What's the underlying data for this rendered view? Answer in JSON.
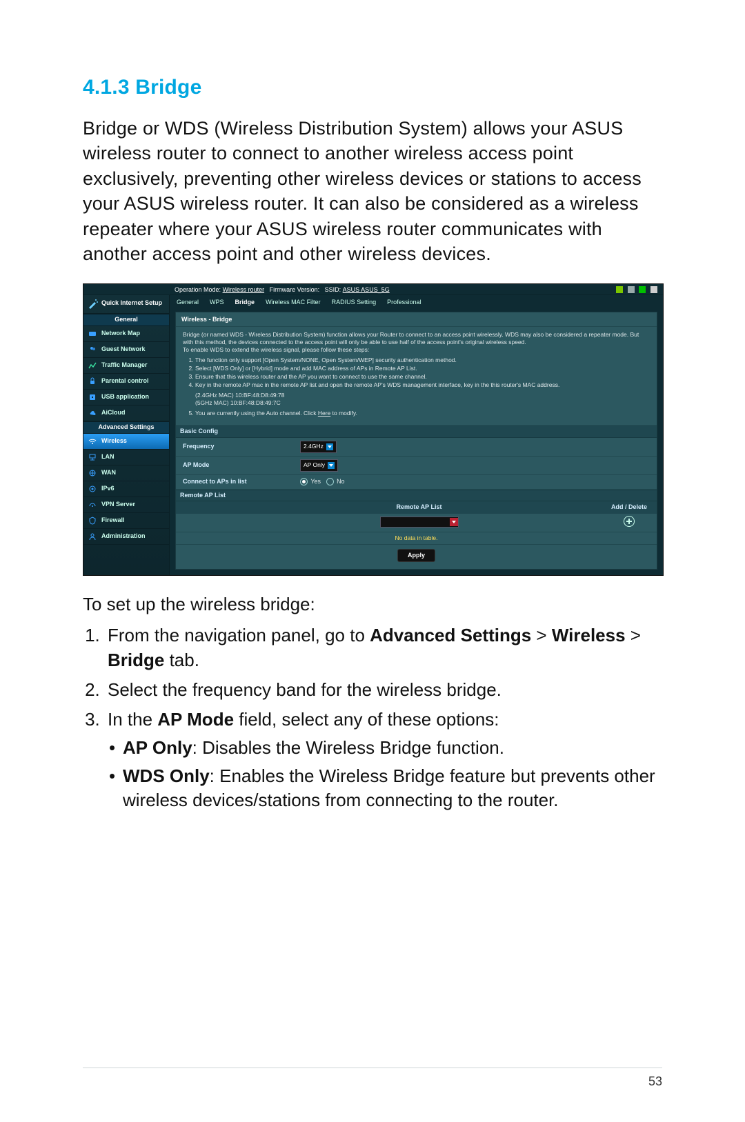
{
  "heading": "4.1.3 Bridge",
  "intro": "Bridge or WDS (Wireless Distribution System) allows your ASUS wireless router to connect to another wireless access point exclusively, preventing other wireless devices or stations to access your ASUS wireless router. It can also be considered as a wireless repeater where your ASUS wireless router communicates with another access point and other wireless devices.",
  "shot": {
    "top": {
      "op_mode_label": "Operation Mode:",
      "op_mode_value": "Wireless router",
      "fw_label": "Firmware Version:",
      "ssid_label": "SSID:",
      "ssid_value": "ASUS  ASUS_5G"
    },
    "qis": "Quick Internet Setup",
    "section_general": "General",
    "general_items": [
      "Network Map",
      "Guest Network",
      "Traffic Manager",
      "Parental control",
      "USB application",
      "AiCloud"
    ],
    "section_adv": "Advanced Settings",
    "adv_items": [
      "Wireless",
      "LAN",
      "WAN",
      "IPv6",
      "VPN Server",
      "Firewall",
      "Administration"
    ],
    "tabs": [
      "General",
      "WPS",
      "Bridge",
      "Wireless MAC Filter",
      "RADIUS Setting",
      "Professional"
    ],
    "panel_title": "Wireless - Bridge",
    "panel_desc1": "Bridge (or named WDS - Wireless Distribution System) function allows your Router to connect to an access point wirelessly. WDS may also be considered a repeater mode. But with this method, the devices connected to the access point will only be able to use half of the access point's original wireless speed.",
    "panel_desc2": "To enable WDS to extend the wireless signal, please follow these steps:",
    "panel_steps": [
      "The function only support [Open System/NONE, Open System/WEP] security authentication method.",
      "Select [WDS Only] or [Hybrid] mode and add MAC address of APs in Remote AP List.",
      "Ensure that this wireless router and the AP you want to connect to use the same channel.",
      "Key in the remote AP mac in the remote AP list and open the remote AP's WDS management interface, key in the this router's MAC address."
    ],
    "mac24": "(2.4GHz MAC) 10:BF:48:D8:49:78",
    "mac5": "(5GHz MAC) 10:BF:48:D8:49:7C",
    "note5_before": "You are currently using the Auto channel. Click ",
    "note5_link": "Here",
    "note5_after": " to modify.",
    "basic_config": "Basic Config",
    "form": {
      "freq_label": "Frequency",
      "freq_value": "2.4GHz",
      "apmode_label": "AP Mode",
      "apmode_value": "AP Only",
      "connect_label": "Connect to APs in list",
      "yes": "Yes",
      "no": "No"
    },
    "remote": {
      "header": "Remote AP List",
      "col_list": "Remote AP List",
      "col_action": "Add / Delete",
      "nodata": "No data in table.",
      "apply": "Apply"
    }
  },
  "after": {
    "lead": "To set up the wireless bridge:",
    "step1a": "From the navigation panel, go to ",
    "step1_b1": "Advanced Settings",
    "step1_gt1": " > ",
    "step1_b2": "Wireless",
    "step1_gt2": " > ",
    "step1_b3": "Bridge",
    "step1_end": " tab.",
    "step2": "Select the frequency band for the wireless bridge.",
    "step3a": "In the ",
    "step3b": "AP Mode",
    "step3c": " field, select any of these options:",
    "bullet1b": "AP Only",
    "bullet1t": ": Disables the Wireless Bridge function.",
    "bullet2b": "WDS Only",
    "bullet2t": ": Enables the Wireless Bridge feature but prevents other wireless devices/stations from connecting to the router."
  },
  "page_number": "53"
}
